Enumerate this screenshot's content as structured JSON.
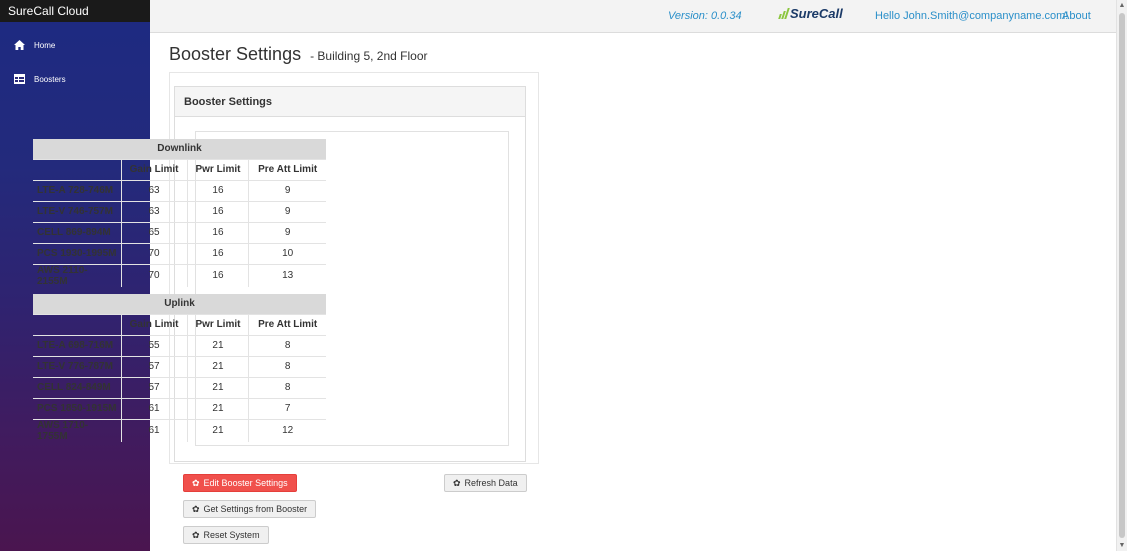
{
  "app": {
    "brand": "SureCall Cloud"
  },
  "sidebar": {
    "items": [
      {
        "label": "Home",
        "icon": "home-icon"
      },
      {
        "label": "Boosters",
        "icon": "table-icon"
      }
    ]
  },
  "topbar": {
    "version": "Version: 0.0.34",
    "logo_text": "SureCall",
    "greeting": "Hello John.Smith@companyname.com!",
    "about": "About"
  },
  "page": {
    "title": "Booster Settings",
    "subtitle": "- Building 5, 2nd Floor",
    "panel_title": "Booster Settings"
  },
  "downlink": {
    "title": "Downlink",
    "columns": [
      "",
      "Gain Limit",
      "Pwr Limit",
      "Pre Att Limit"
    ],
    "rows": [
      {
        "band": "LTE-A 728-746M",
        "gain": "63",
        "pwr": "16",
        "preatt": "9"
      },
      {
        "band": "LTE-V 746-757M",
        "gain": "63",
        "pwr": "16",
        "preatt": "9"
      },
      {
        "band": "CELL 869-894M",
        "gain": "65",
        "pwr": "16",
        "preatt": "9"
      },
      {
        "band": "PCS 1930-1995M",
        "gain": "70",
        "pwr": "16",
        "preatt": "10"
      },
      {
        "band": "AWS 2110-2155M",
        "gain": "70",
        "pwr": "16",
        "preatt": "13"
      }
    ]
  },
  "uplink": {
    "title": "Uplink",
    "columns": [
      "",
      "Gain Limit",
      "Pwr Limit",
      "Pre Att Limit"
    ],
    "rows": [
      {
        "band": "LTE-A 698-716M",
        "gain": "55",
        "pwr": "21",
        "preatt": "8"
      },
      {
        "band": "LTE-V 776-787M",
        "gain": "57",
        "pwr": "21",
        "preatt": "8"
      },
      {
        "band": "CELL 824-849M",
        "gain": "57",
        "pwr": "21",
        "preatt": "8"
      },
      {
        "band": "PCS 1850-1915M",
        "gain": "61",
        "pwr": "21",
        "preatt": "7"
      },
      {
        "band": "AWS 1710-1755M",
        "gain": "61",
        "pwr": "21",
        "preatt": "12"
      }
    ]
  },
  "buttons": {
    "edit": "Edit Booster Settings",
    "refresh": "Refresh Data",
    "get": "Get Settings from Booster",
    "reset": "Reset System"
  },
  "colors": {
    "danger": "#f0504c",
    "link": "#2a8fc9",
    "logo_green": "#8cc63f",
    "logo_navy": "#1b3a67"
  }
}
